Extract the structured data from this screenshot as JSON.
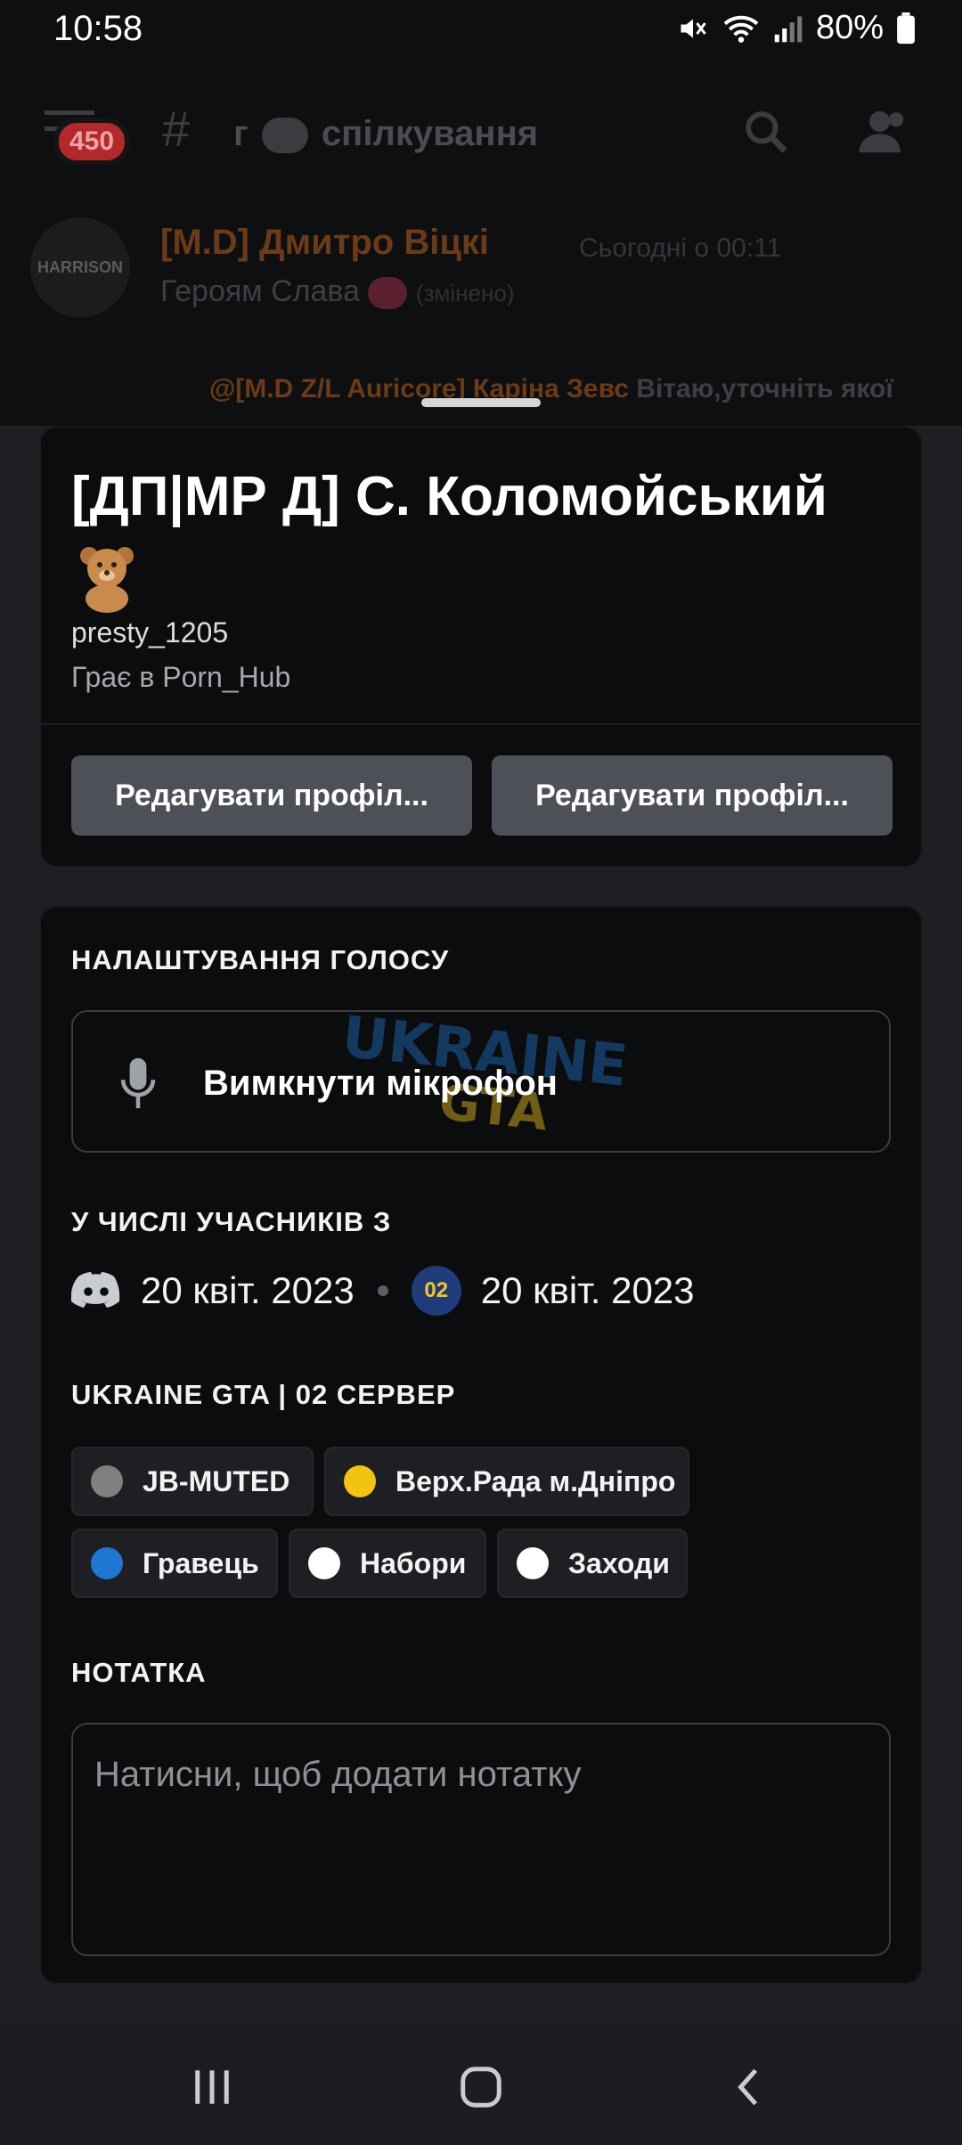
{
  "status_bar": {
    "time": "10:58",
    "battery": "80%"
  },
  "top_bar": {
    "unread_count": "450",
    "hash": "#",
    "channel_prefix": "г",
    "channel_name": "спілкування"
  },
  "background_message": {
    "avatar_text": "HARRISON",
    "author": "[M.D] Дмитро Віцкі",
    "timestamp": "Сьогодні о 00:11",
    "text": "Героям Слава",
    "edited": "(змінено)",
    "reply_author": "@[M.D Z/L Auricore] Каріна Зевс",
    "reply_text": "Вітаю,уточніть якої"
  },
  "profile": {
    "display_name": "[ДП|МР Д] С. Коломойський",
    "username": "presty_1205",
    "activity": "Грає в Porn_Hub",
    "button_1": "Редагувати профіл...",
    "button_2": "Редагувати профіл..."
  },
  "voice": {
    "title": "НАЛАШТУВАННЯ ГОЛОСУ",
    "mute_label": "Вимкнути мікрофон",
    "watermark_line1": "UKRAINE",
    "watermark_line2": "GTA"
  },
  "member_since": {
    "title": "У ЧИСЛІ УЧАСНИКІВ З",
    "discord_date": "20 квіт. 2023",
    "server_badge": "02",
    "server_date": "20 квіт. 2023"
  },
  "roles": {
    "title": "UKRAINE GTA | 02 СЕРВЕР",
    "items": [
      {
        "label": "JB-MUTED",
        "color": "#808080"
      },
      {
        "label": "Верх.Рада м.Дніпро",
        "color": "#f1c40f"
      },
      {
        "label": "Гравець",
        "color": "#1e78d2"
      },
      {
        "label": "Набори",
        "color": "#ffffff"
      },
      {
        "label": "Заходи",
        "color": "#ffffff"
      }
    ]
  },
  "note": {
    "title": "НОТАТКА",
    "placeholder": "Натисни, щоб додати нотатку"
  }
}
